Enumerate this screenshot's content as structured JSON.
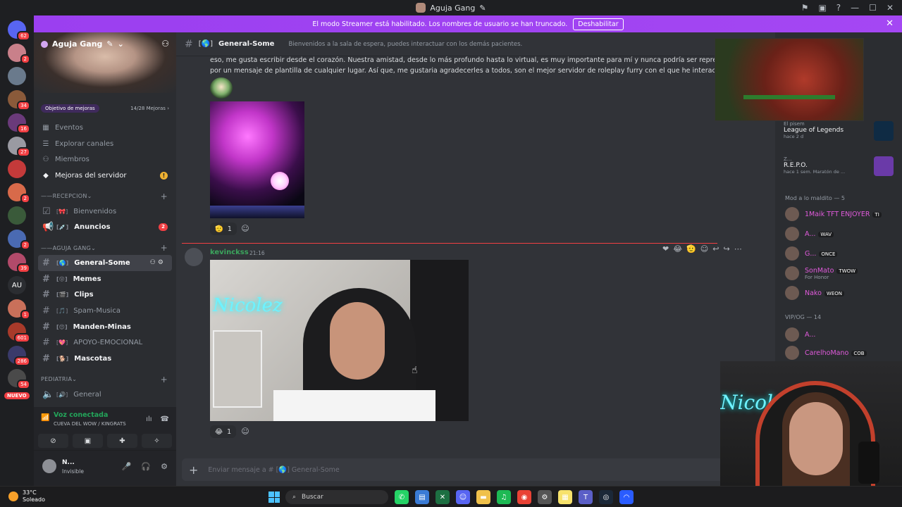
{
  "titlebar": {
    "title": "Aguja Gang",
    "icons": [
      "flag-icon",
      "inbox-icon",
      "help-icon",
      "minimize-icon",
      "maximize-icon",
      "close-icon"
    ]
  },
  "banner": {
    "text": "El modo Streamer está habilitado. Los nombres de usuario se han truncado.",
    "button": "Deshabilitar"
  },
  "guilds": [
    {
      "badge": "62",
      "color": "#5865f2"
    },
    {
      "badge": "2",
      "color": "#c9808a"
    },
    {
      "badge": "",
      "color": "#6a7a8c"
    },
    {
      "badge": "34",
      "color": "#8a5a3a"
    },
    {
      "badge": "16",
      "color": "#6a3a7a"
    },
    {
      "badge": "27",
      "color": "#9a9aa2"
    },
    {
      "badge": "",
      "color": "#c43a3a"
    },
    {
      "badge": "2",
      "color": "#d86a4a"
    },
    {
      "badge": "",
      "color": "#3a5a3a"
    },
    {
      "badge": "2",
      "color": "#4a6ab2"
    },
    {
      "badge": "39",
      "color": "#b24a6a"
    }
  ],
  "guilds_more": [
    {
      "badge": "1",
      "color": "#c9705a"
    },
    {
      "badge": "601",
      "color": "#a83a2a"
    },
    {
      "badge": "286",
      "color": "#3a3a6a"
    },
    {
      "badge": "54",
      "color": "#4a4a4a"
    }
  ],
  "guild_au": "AU",
  "nuevo": "NUEVO",
  "server": {
    "name": "Aguja Gang",
    "boost_label": "Objetivo de mejoras",
    "boost_progress": "14/28 Mejoras"
  },
  "side_items": [
    {
      "label": "Eventos"
    },
    {
      "label": "Explorar canales"
    },
    {
      "label": "Miembros"
    },
    {
      "label": "Mejoras del servidor"
    }
  ],
  "categories": {
    "recepcion": "RECEPCION",
    "aguja": "AGUJA GANG",
    "pediatria": "PEDIATRIA"
  },
  "channels_recepcion": [
    {
      "name": "Bienvenidos",
      "badge": ""
    },
    {
      "name": "Anuncios",
      "badge": "2"
    }
  ],
  "channels_aguja": [
    {
      "name": "General-Some"
    },
    {
      "name": "Memes"
    },
    {
      "name": "Clips"
    },
    {
      "name": "Spam-Musica"
    },
    {
      "name": "Manden-Minas"
    },
    {
      "name": "APOYO-EMOCIONAL"
    },
    {
      "name": "Mascotas"
    }
  ],
  "voice_channel": "General",
  "voice": {
    "title": "Voz conectada",
    "sub": "CUEVA DEL WOW / KINGRATS"
  },
  "user": {
    "name": "N...",
    "status": "Invisible"
  },
  "chat": {
    "channel": "General-Some",
    "topic": "Bienvenidos a la sala de espera, puedes interactuar con los demás pacientes.",
    "message_text": "eso, me gusta escribir desde el corazón. Nuestra amistad, desde lo más profundo hasta lo virtual, es muy importante para mí y nunca podría ser representada por un mensaje de plantilla de cualquier lugar. Así que, me gustaria agradecerles a todos, son el mejor servidor de roleplay furry con el que he interactuado",
    "reaction1_count": "1",
    "author2": "kevinckss",
    "time2": "21:16",
    "video_neon": "Nicolez",
    "reaction2_count": "1",
    "composer_placeholder": "Enviar mensaje a #",
    "composer_channel": "General-Some"
  },
  "members": {
    "card1": {
      "label": "El pisem",
      "title": "League of Legends",
      "sub": "hace 2 d"
    },
    "card2": {
      "label": "Z...",
      "title": "R.E.P.O.",
      "sub": "hace 1 sem.  Maratón de ..."
    },
    "cat1": "Mod a lo maldito — 5",
    "mods": [
      {
        "name": "1Maik TFT ENJOYER",
        "tag": "TI",
        "color": "#e05adb",
        "sub": ""
      },
      {
        "name": "A...",
        "tag": "WAV",
        "color": "#e05adb",
        "sub": ""
      },
      {
        "name": "G...",
        "tag": "ONCE",
        "color": "#e05adb",
        "sub": ""
      },
      {
        "name": "SonMato",
        "tag": "TWOW",
        "color": "#e05adb",
        "sub": "For Honor"
      },
      {
        "name": "Nako",
        "tag": "WEON",
        "color": "#e05adb",
        "sub": ""
      }
    ],
    "cat2": "VIP/OG — 14",
    "vips": [
      {
        "name": "A...",
        "tag": "",
        "color": "#e05adb"
      },
      {
        "name": "CarelhoMano",
        "tag": "COB",
        "color": "#e05adb"
      }
    ]
  },
  "taskbar": {
    "temp": "33°C",
    "weather": "Soleado",
    "search": "Buscar",
    "apps": [
      {
        "name": "whatsapp-icon",
        "color": "#25d366",
        "glyph": "✆"
      },
      {
        "name": "notepad-icon",
        "color": "#3a7bd5",
        "glyph": "▤"
      },
      {
        "name": "excel-icon",
        "color": "#1d6f42",
        "glyph": "✕"
      },
      {
        "name": "discord-icon",
        "color": "#5865f2",
        "glyph": "☺"
      },
      {
        "name": "folder-icon",
        "color": "#f0c14b",
        "glyph": "▬"
      },
      {
        "name": "spotify-icon",
        "color": "#1db954",
        "glyph": "♫"
      },
      {
        "name": "chrome-icon",
        "color": "#e94235",
        "glyph": "◉"
      },
      {
        "name": "settings-icon",
        "color": "#555",
        "glyph": "⚙"
      },
      {
        "name": "sticky-notes-icon",
        "color": "#f7e26b",
        "glyph": "▦"
      },
      {
        "name": "teams-icon",
        "color": "#5b5fc7",
        "glyph": "T"
      },
      {
        "name": "steam-icon",
        "color": "#1b2838",
        "glyph": "◎"
      },
      {
        "name": "arc-icon",
        "color": "#2a5cff",
        "glyph": "◠"
      }
    ]
  }
}
